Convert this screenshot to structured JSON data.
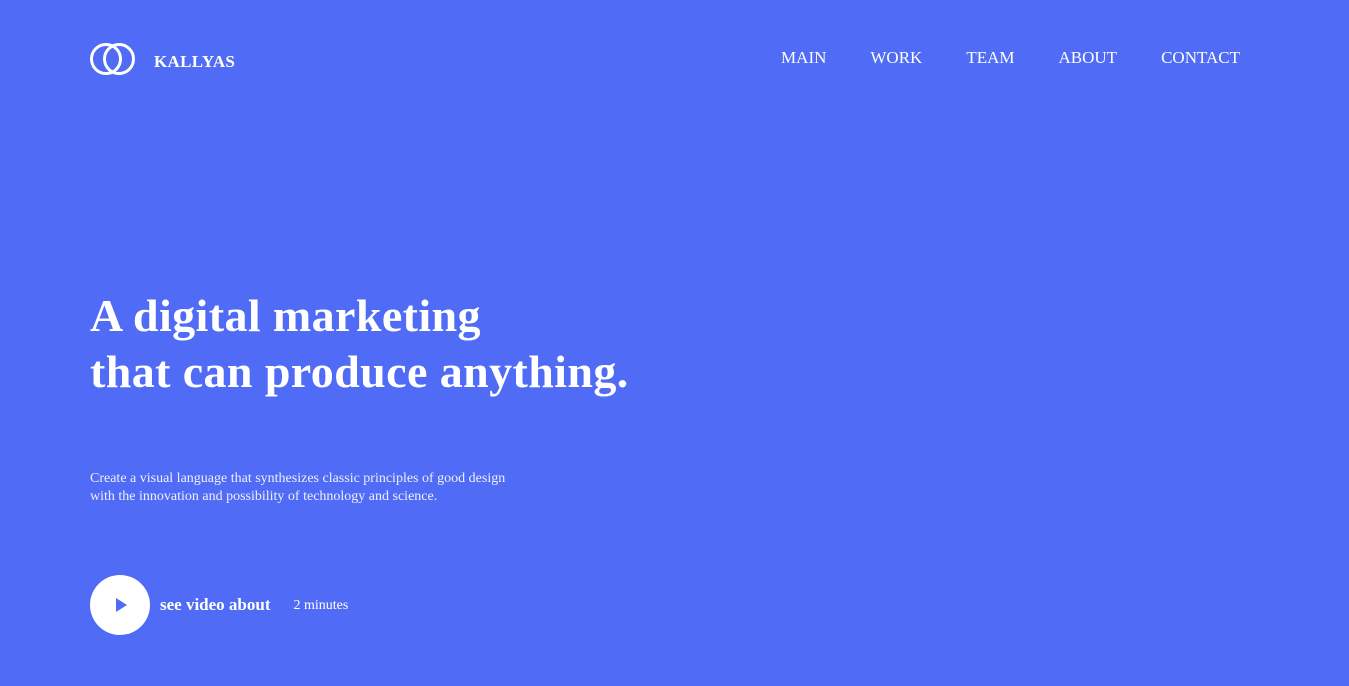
{
  "brand": {
    "name": "KALLYAS",
    "logo_icon": "double-ring-logo"
  },
  "nav": {
    "items": [
      "MAIN",
      "WORK",
      "TEAM",
      "ABOUT",
      "CONTACT"
    ]
  },
  "hero": {
    "title_line1": "A digital marketing",
    "title_line2": "that can produce anything.",
    "subtitle_line1": "Create a visual language that synthesizes classic principles of good design",
    "subtitle_line2": "with the innovation and possibility of technology and science."
  },
  "video": {
    "play_icon": "play-icon",
    "label": "see video about",
    "duration": "2 minutes"
  },
  "colors": {
    "background": "#506bf5",
    "text": "#ffffff"
  }
}
